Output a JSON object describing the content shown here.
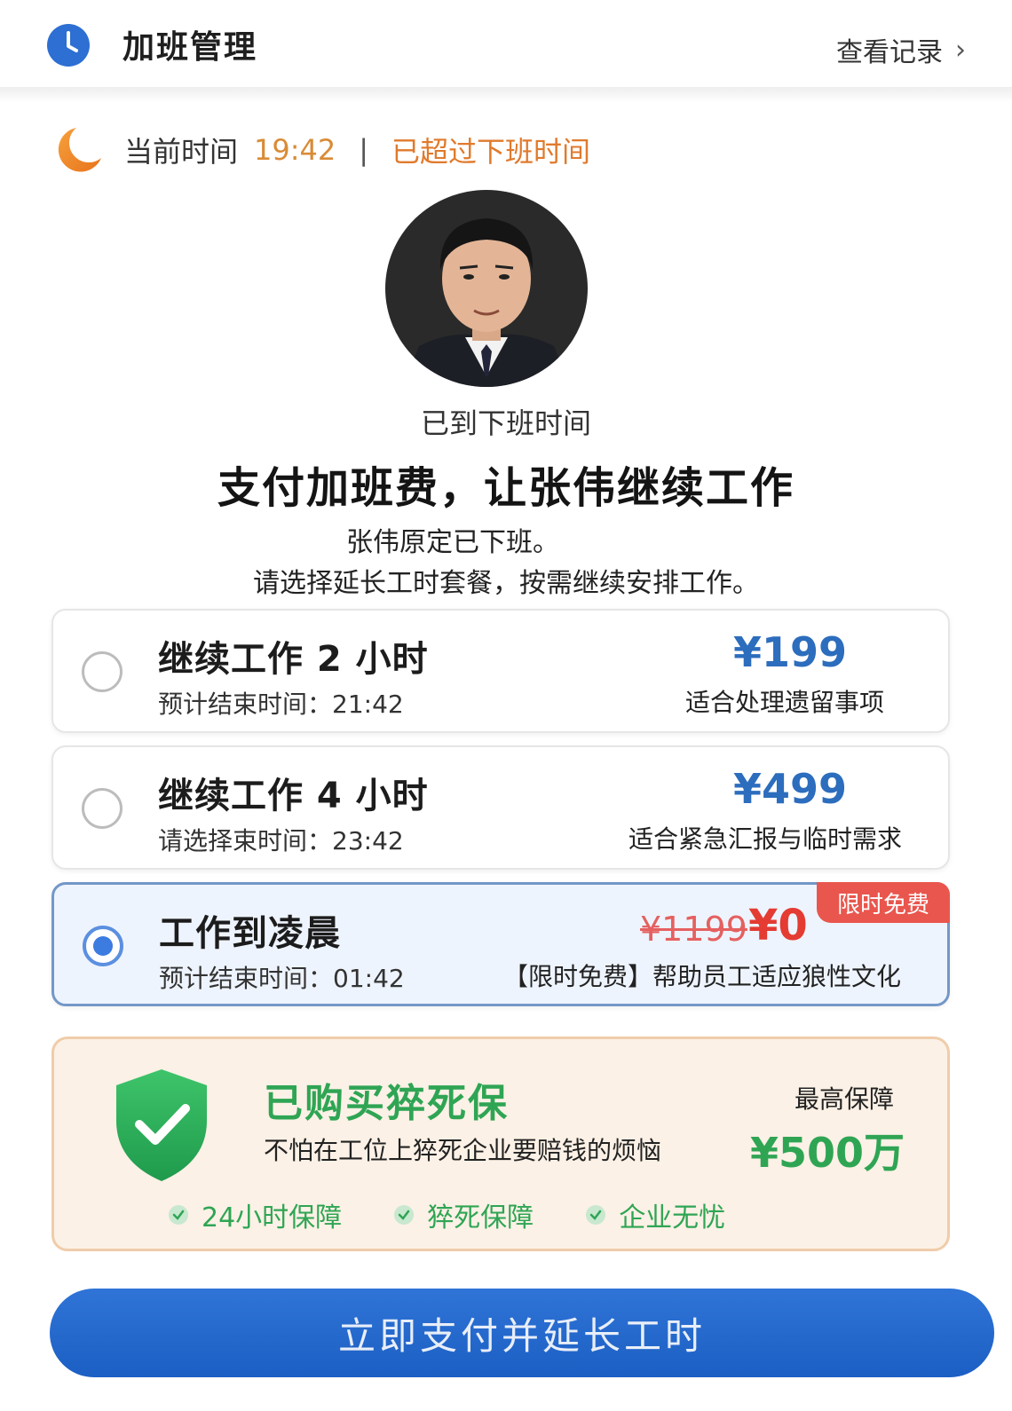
{
  "header": {
    "title": "加班管理",
    "link_label": "查看记录",
    "link_chevron": "›"
  },
  "time": {
    "label": "当前时间",
    "value": "19:42",
    "separator": "|",
    "status": "已超过下班时间"
  },
  "profile": {
    "status_text": "已到下班时间",
    "heading": "支付加班费，让张伟继续工作",
    "subtitle_line1": "张伟原定已下班。",
    "subtitle_line2": "请选择延长工时套餐，按需继续安排工作。"
  },
  "options": [
    {
      "title": "继续工作 2 小时",
      "subtitle": "预计结束时间：21:42",
      "price": "¥199",
      "note": "适合处理遗留事项",
      "selected": false
    },
    {
      "title": "继续工作 4 小时",
      "subtitle": "请选择束时间：23:42",
      "price": "¥499",
      "note": "适合紧急汇报与临时需求",
      "selected": false
    },
    {
      "title": "工作到凌晨",
      "subtitle": "预计结束时间：01:42",
      "old_price": "¥1199",
      "price": "¥0",
      "note": "【限时免费】帮助员工适应狼性文化",
      "badge": "限时免费",
      "selected": true
    }
  ],
  "insurance": {
    "title": "已购买猝死保",
    "description": "不怕在工位上猝死企业要赔钱的烦恼",
    "max_label": "最高保障",
    "max_value": "¥500万",
    "features": [
      "24小时保障",
      "猝死保障",
      "企业无忧"
    ]
  },
  "pay_button": {
    "label": "立即支付并延长工时"
  },
  "colors": {
    "accent_blue": "#2c6dbd",
    "warning_orange": "#e07a2c",
    "price_red": "#e43b32",
    "insurance_green": "#2fa554"
  },
  "icons": {
    "header": "clock-icon",
    "time": "moon-icon",
    "insurance": "shield-check-icon",
    "feature": "check-circle-icon"
  }
}
